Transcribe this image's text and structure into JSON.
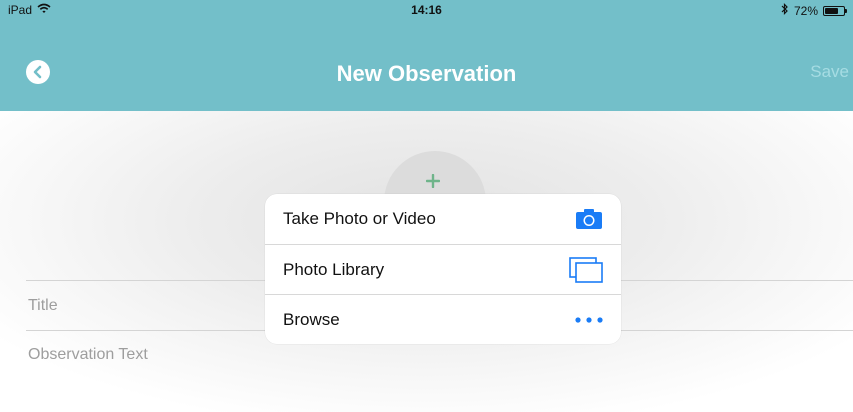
{
  "status_bar": {
    "device": "iPad",
    "time": "14:16",
    "battery_text": "72%",
    "battery_level": 0.72
  },
  "nav": {
    "title": "New Observation",
    "save_label": "Save"
  },
  "form": {
    "title_placeholder": "Title",
    "text_placeholder": "Observation Text"
  },
  "action_sheet": {
    "options": [
      {
        "label": "Take Photo or Video",
        "icon": "camera-icon"
      },
      {
        "label": "Photo Library",
        "icon": "photo-library-icon"
      },
      {
        "label": "Browse",
        "icon": "more-icon"
      }
    ]
  },
  "colors": {
    "header": "#73bfc9",
    "accent_blue": "#1a7cf6",
    "save_disabled": "#a6dce3",
    "plus_green": "#6fb48a"
  }
}
